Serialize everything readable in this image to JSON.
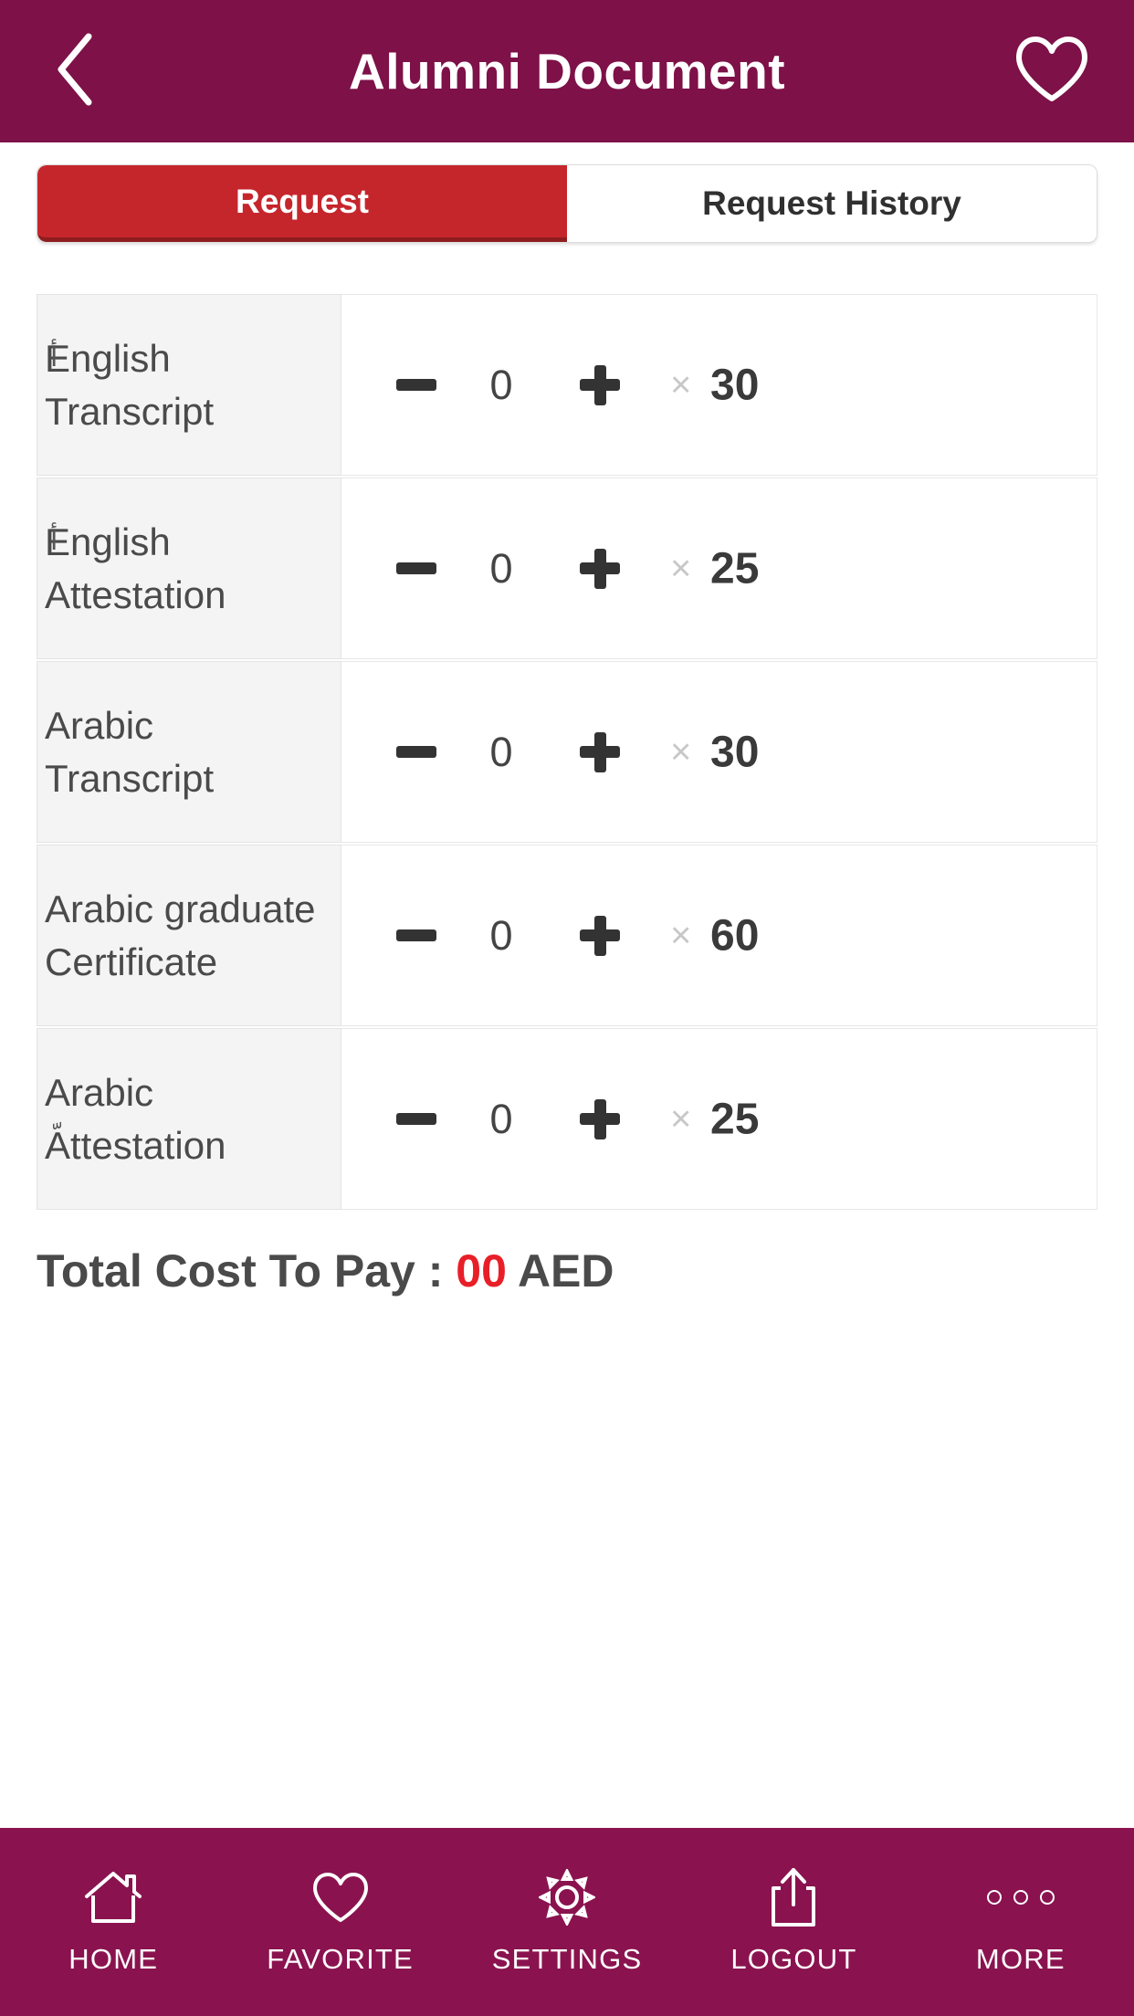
{
  "header": {
    "title": "Alumni Document",
    "back_icon": "chevron-left-icon",
    "favorite_icon": "heart-outline-icon",
    "background_color": "#7d1148"
  },
  "tabs": [
    {
      "label": "Request",
      "active": true
    },
    {
      "label": "Request History",
      "active": false
    }
  ],
  "tab_colors": {
    "active_bg": "#c5262c",
    "active_text": "#ffffff",
    "inactive_text": "#303030"
  },
  "documents": [
    {
      "name_line1": "English",
      "name_line2": "Transcript",
      "diacritic": "أ",
      "quantity": "0",
      "multiply_symbol": "×",
      "price": "30"
    },
    {
      "name_line1": "English",
      "name_line2": "Attestation",
      "diacritic": "أ",
      "quantity": "0",
      "multiply_symbol": "×",
      "price": "25"
    },
    {
      "name_line1": "Arabic",
      "name_line2": "Transcript",
      "diacritic": "",
      "quantity": "0",
      "multiply_symbol": "×",
      "price": "30"
    },
    {
      "name_line1": "Arabic graduate",
      "name_line2": "Certificate",
      "diacritic": "",
      "quantity": "0",
      "multiply_symbol": "×",
      "price": "60"
    },
    {
      "name_line1": "Arabic",
      "name_line2": "Attestation",
      "diacritic": "ّ",
      "quantity": "0",
      "multiply_symbol": "×",
      "price": "25"
    }
  ],
  "total": {
    "label": "Total Cost To Pay : ",
    "amount": "00",
    "currency": " AED",
    "amount_color": "#e81f28"
  },
  "bottom_nav": [
    {
      "label": "HOME",
      "icon": "home-icon"
    },
    {
      "label": "FAVORITE",
      "icon": "heart-outline-icon"
    },
    {
      "label": "SETTINGS",
      "icon": "gear-icon"
    },
    {
      "label": "LOGOUT",
      "icon": "share-export-icon"
    },
    {
      "label": "MORE",
      "icon": "ellipsis-icon"
    }
  ],
  "bottom_nav_color": "#8a134f"
}
